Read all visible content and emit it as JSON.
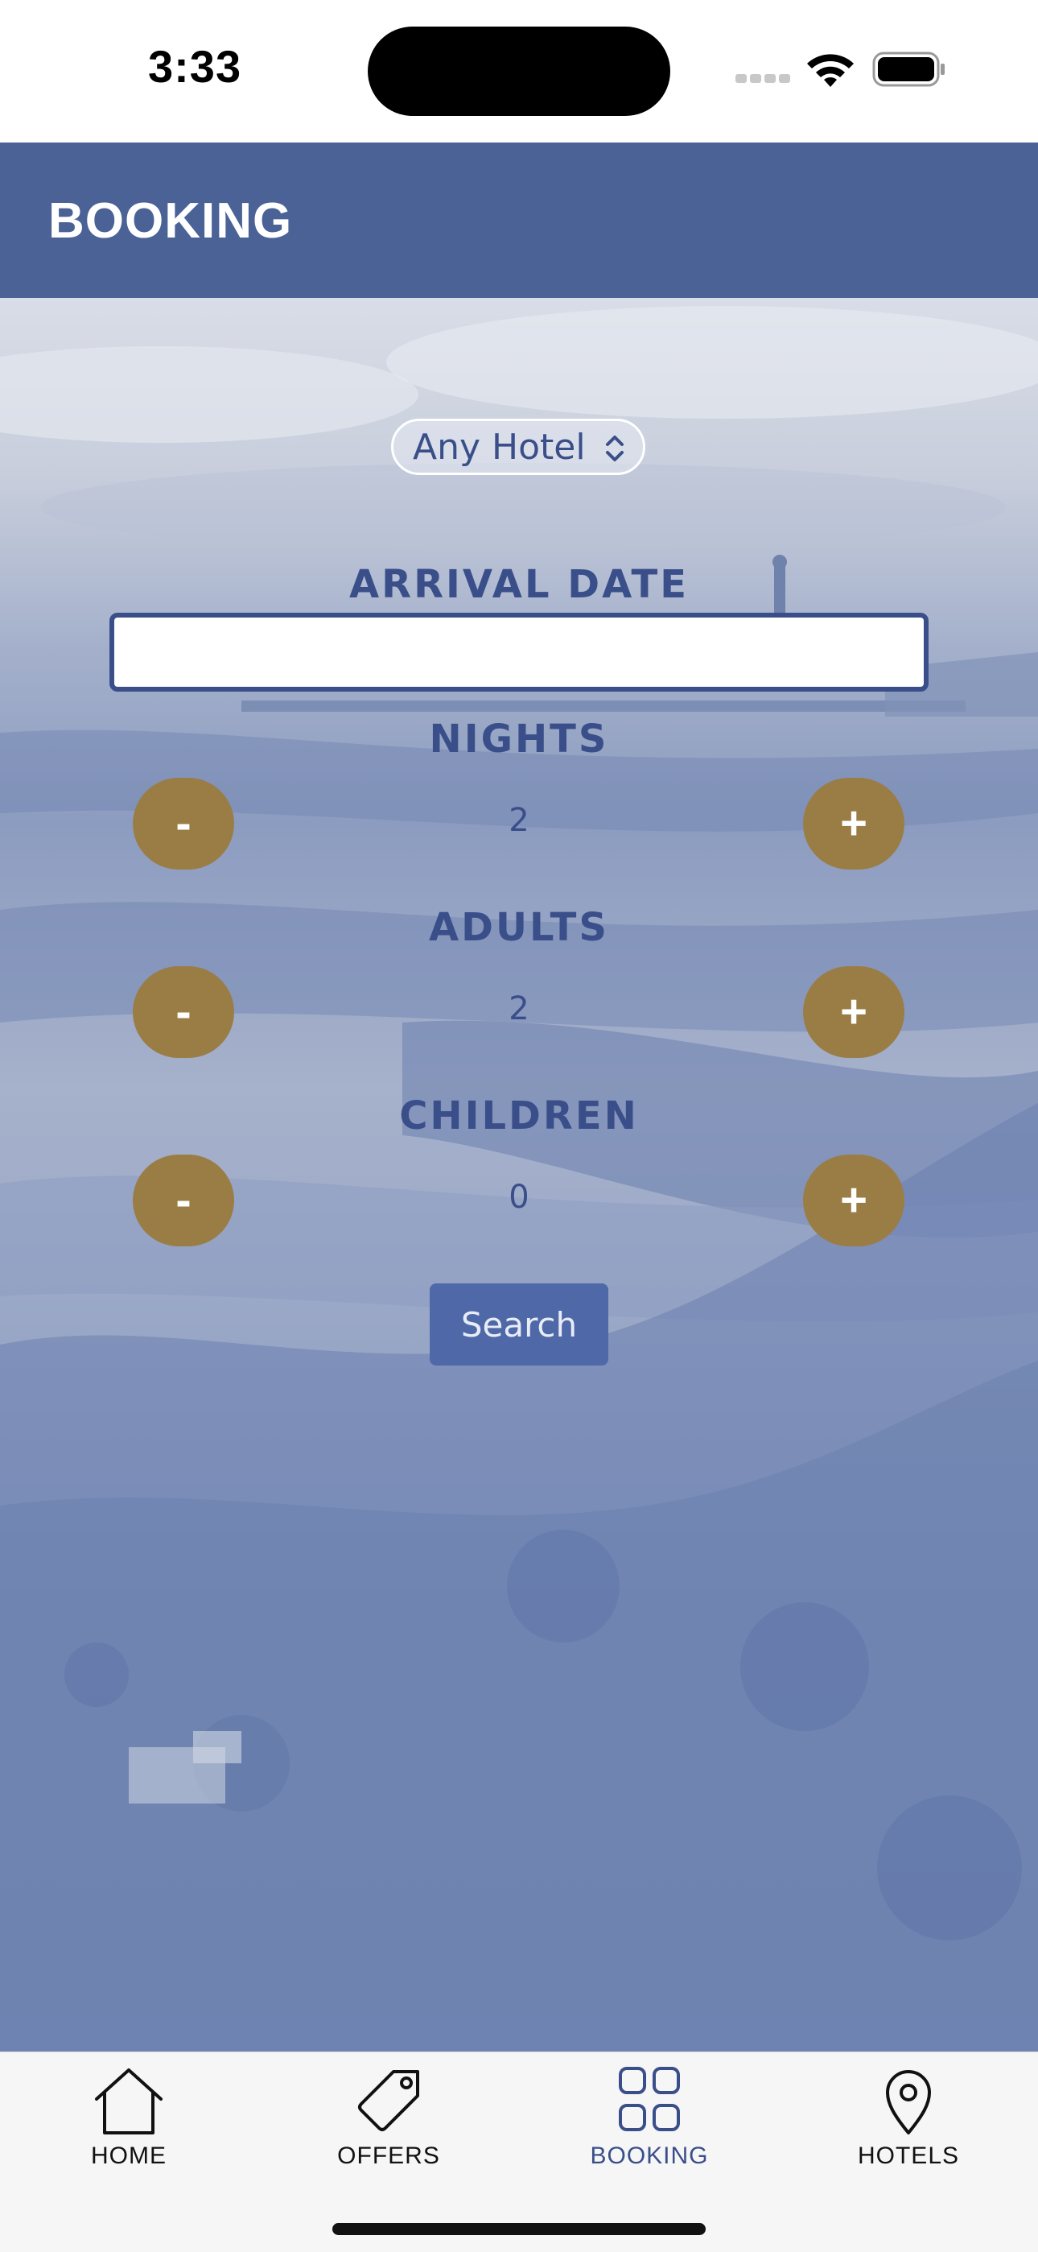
{
  "status_bar": {
    "time": "3:33"
  },
  "header": {
    "title": "BOOKING"
  },
  "booking": {
    "hotel_select": {
      "value": "Any Hotel"
    },
    "arrival_date": {
      "label": "ARRIVAL DATE",
      "value": ""
    },
    "nights": {
      "label": "NIGHTS",
      "value": "2"
    },
    "adults": {
      "label": "ADULTS",
      "value": "2"
    },
    "children": {
      "label": "CHILDREN",
      "value": "0"
    },
    "decrement_label": "-",
    "increment_label": "+",
    "search_label": "Search"
  },
  "tabs": [
    {
      "label": "HOME",
      "icon": "home-icon",
      "active": false
    },
    {
      "label": "OFFERS",
      "icon": "tag-icon",
      "active": false
    },
    {
      "label": "BOOKING",
      "icon": "grid-icon",
      "active": true
    },
    {
      "label": "HOTELS",
      "icon": "location-pin-icon",
      "active": false
    }
  ],
  "colors": {
    "header": "#4a6296",
    "accent": "#3a4f8a",
    "stepper": "#9a7d45",
    "search_button": "#4e68a8"
  }
}
